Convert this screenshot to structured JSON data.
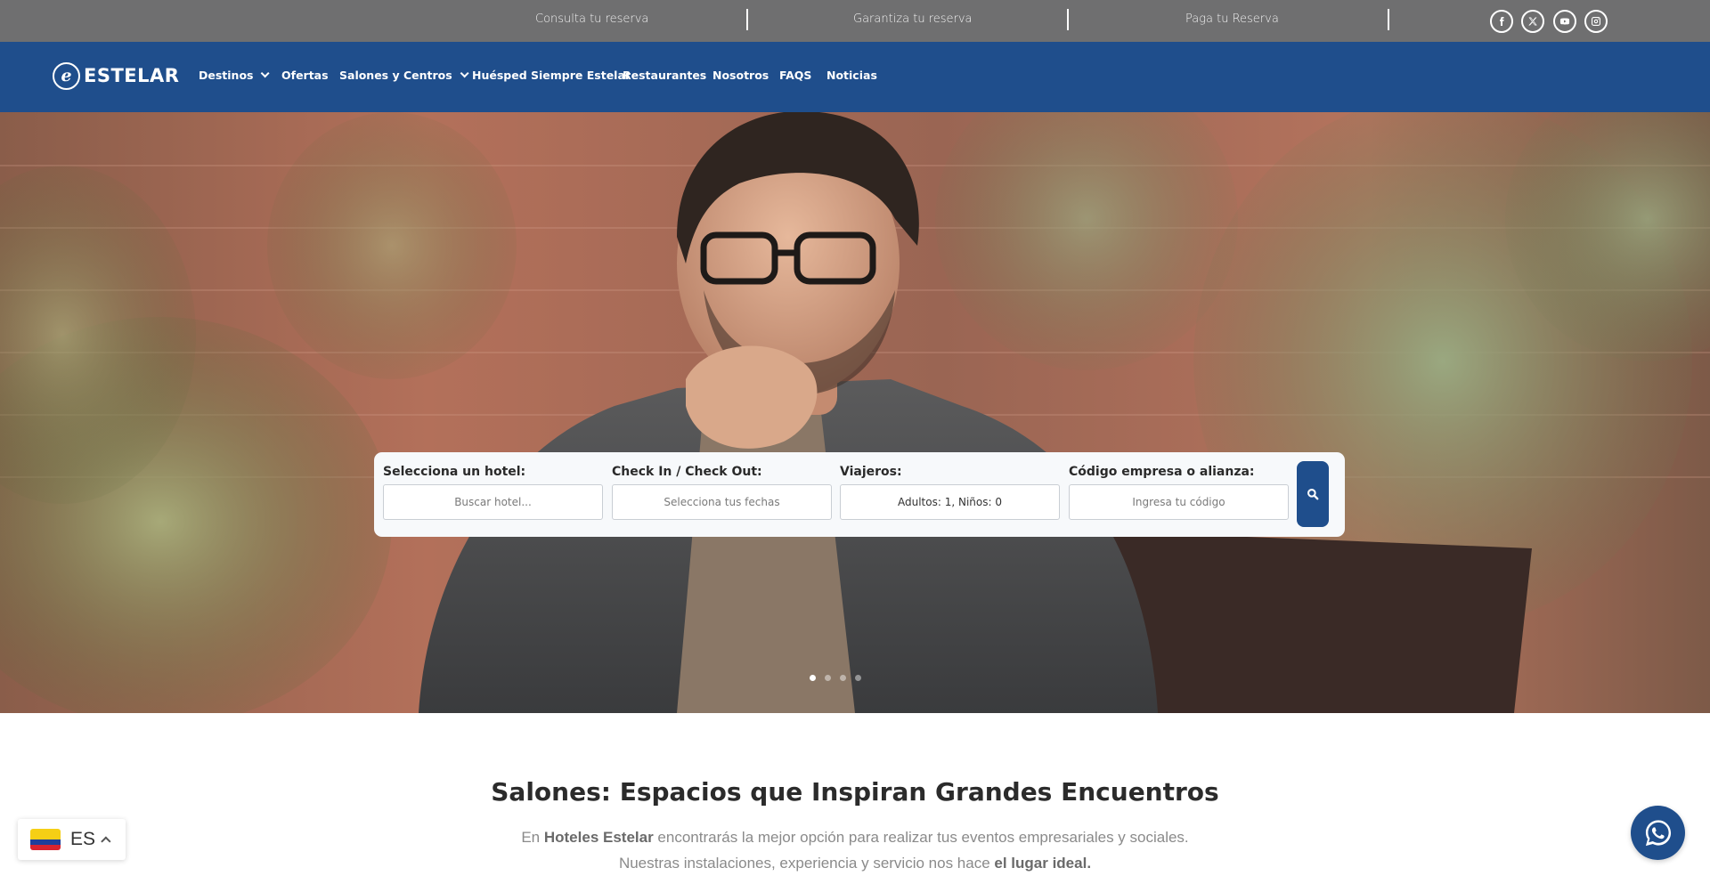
{
  "topbar": {
    "links": [
      "Consulta tu reserva",
      "Garantiza tu reserva",
      "Paga tu Reserva"
    ],
    "social_icons": [
      "facebook-icon",
      "x-twitter-icon",
      "youtube-icon",
      "instagram-icon"
    ]
  },
  "nav": {
    "logo_text": "ESTELAR",
    "logo_mark": "e",
    "items": [
      {
        "label": "Destinos"
      },
      {
        "label": "Ofertas"
      },
      {
        "label": "Salones y Centros"
      },
      {
        "label": "Huésped Siempre Estelar"
      },
      {
        "label": "Restaurantes"
      },
      {
        "label": "Nosotros"
      },
      {
        "label": "FAQS"
      },
      {
        "label": "Noticias"
      }
    ]
  },
  "search": {
    "hotel_label": "Selecciona un hotel:",
    "hotel_placeholder": "Buscar hotel...",
    "dates_label": "Check In / Check Out:",
    "dates_placeholder": "Selecciona tus fechas",
    "travelers_label": "Viajeros:",
    "travelers_value": "Adultos: 1, Niños: 0",
    "code_label": "Código empresa o alianza:",
    "code_placeholder": "Ingresa tu código",
    "button_icon": "search-icon"
  },
  "carousel": {
    "slides": 4,
    "active": 1
  },
  "intro": {
    "title": "Salones: Espacios que Inspiran Grandes Encuentros",
    "line1_a": "En ",
    "line1_b": "Hoteles Estelar",
    "line1_c": " encontrarás la mejor opción para realizar tus eventos empresariales y sociales.",
    "line2_a": "Nuestras instalaciones, experiencia y servicio nos hace ",
    "line2_b": "el lugar ideal."
  },
  "language": {
    "code": "ES",
    "flag": "colombia-flag-icon"
  },
  "colors": {
    "brand": "#1f4e8c",
    "topbar": "#6f6f70"
  }
}
